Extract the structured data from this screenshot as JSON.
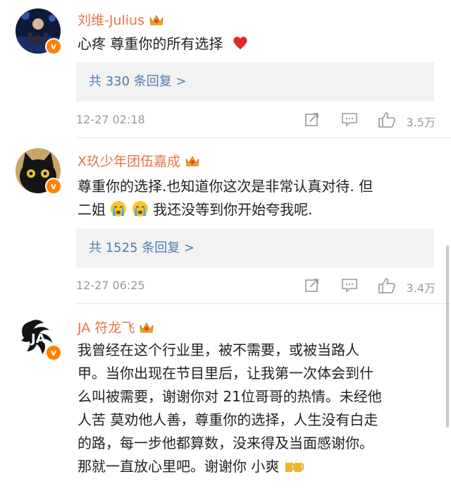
{
  "comments": [
    {
      "name": "刘维-Julius",
      "text": "心疼 尊重你的所有选择",
      "reply_link": "共 330 条回复 >",
      "time": "12-27 02:18",
      "likes": "3.5万"
    },
    {
      "name": "X玖少年团伍嘉成",
      "text_line1": "尊重你的选择.也知道你这次是非常认真对待. 但",
      "text_line2_start": "二姐",
      "text_line2_end": "我还没等到你开始夸我呢.",
      "reply_link": "共 1525 条回复 >",
      "time": "12-27 06:25",
      "likes": "3.4万"
    },
    {
      "name": "JA 符龙飞",
      "lines": [
        "我曾经在这个行业里，被不需要，或被当路人",
        "甲。当你出现在节目里后，让我第一次体会到什",
        "么叫被需要，谢谢你对 21位哥哥的热情。未经他",
        "人苦 莫劝他人善，尊重你的选择，人生没有白走",
        "的路，每一步他都算数，没来得及当面感谢你。",
        "那就一直放心里吧。谢谢你 小爽"
      ]
    }
  ],
  "verified_badge": "v",
  "avatar3_text": "JA",
  "icons": {
    "badge": "crown-badge-icon",
    "heart": "red-heart-emoji",
    "crying": "crying-face-emoji",
    "beer": "beer-mugs-emoji",
    "share": "share-icon",
    "comment": "comment-icon",
    "like": "thumbs-up-icon"
  },
  "colors": {
    "name": "#eb7350",
    "reply_link": "#507daf",
    "meta": "#999999",
    "verified": "#ff8200"
  }
}
